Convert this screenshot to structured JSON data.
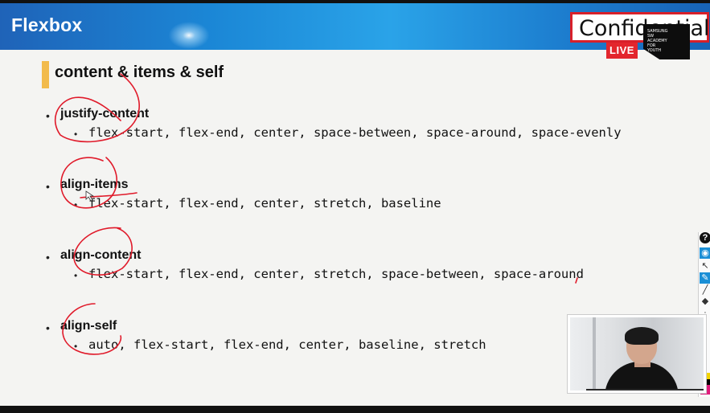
{
  "header": {
    "title": "Flexbox",
    "confidential": "Confidential",
    "academy_lines": [
      "SAMSUNG",
      "SW",
      "ACADEMY",
      "FOR",
      "YOUTH"
    ],
    "live": "LIVE"
  },
  "slide": {
    "title": "content & items & self",
    "bullet_main": "•",
    "bullet_sub": "•",
    "sections": [
      {
        "label": "justify-content",
        "values": "flex-start, flex-end, center, space-between, space-around, space-evenly"
      },
      {
        "label": "align-items",
        "values": "flex-start, flex-end, center, stretch, baseline"
      },
      {
        "label": "align-content",
        "values": "flex-start, flex-end, center, stretch, space-between, space-around"
      },
      {
        "label": "align-self",
        "values": "auto, flex-start, flex-end, center, baseline, stretch"
      }
    ]
  },
  "colors": {
    "header_blue": "#1b87d6",
    "title_accent": "#f2bb4c",
    "annotation_ink": "#e01a2a",
    "live_red": "#e3262d"
  },
  "toolbar": {
    "icons": [
      "help-icon",
      "eye-icon",
      "cursor-icon",
      "pen-icon",
      "line-icon",
      "eraser-icon",
      "dot-icon"
    ]
  }
}
